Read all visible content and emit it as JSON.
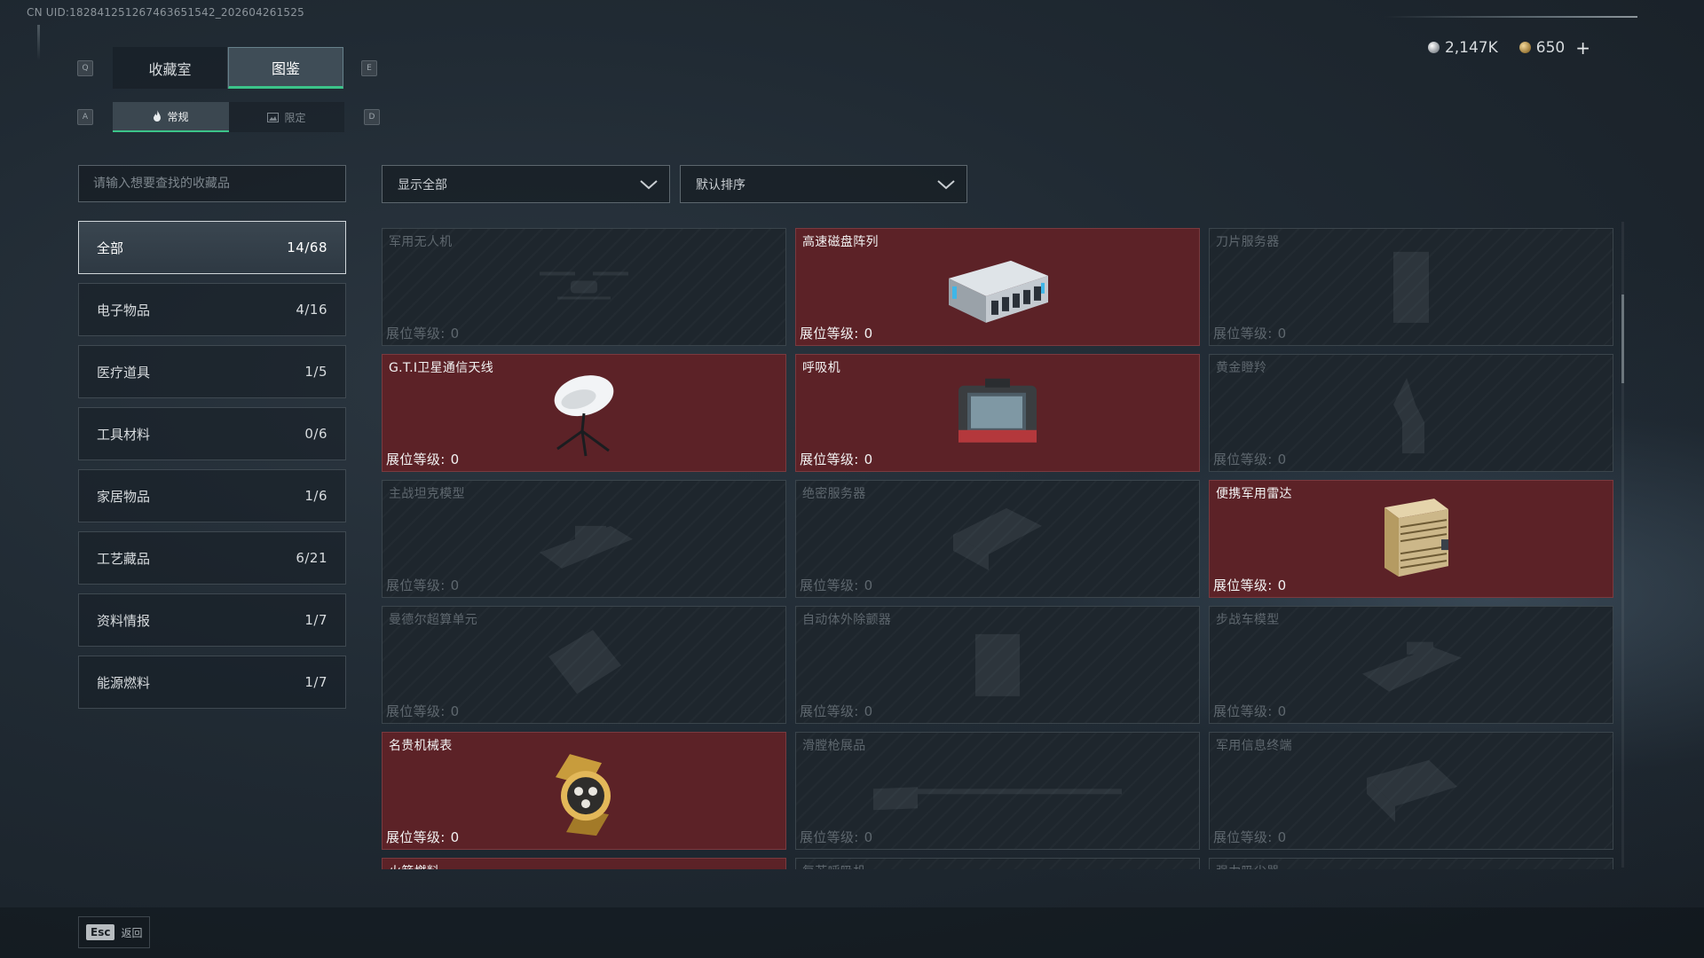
{
  "uid_text": "CN UID:18284125126746365154​2_202604261525",
  "key_hints": {
    "prev_tab": "Q",
    "next_tab": "E",
    "prev_sub": "A",
    "next_sub": "D"
  },
  "main_tabs": [
    {
      "label": "收藏室",
      "active": false
    },
    {
      "label": "图鉴",
      "active": true
    }
  ],
  "sub_tabs": [
    {
      "label": "常规",
      "icon": "flame-icon",
      "active": true
    },
    {
      "label": "限定",
      "icon": "image-icon",
      "active": false
    }
  ],
  "currency": {
    "silver": "2,147K",
    "gold": "650",
    "plus": "+"
  },
  "search": {
    "placeholder": "请输入想要查找的收藏品"
  },
  "filter": {
    "selected": "显示全部"
  },
  "sort": {
    "selected": "默认排序"
  },
  "categories": [
    {
      "label": "全部",
      "count": "14/68",
      "active": true
    },
    {
      "label": "电子物品",
      "count": "4/16"
    },
    {
      "label": "医疗道具",
      "count": "1/5"
    },
    {
      "label": "工具材料",
      "count": "0/6"
    },
    {
      "label": "家居物品",
      "count": "1/6"
    },
    {
      "label": "工艺藏品",
      "count": "6/21"
    },
    {
      "label": "资料情报",
      "count": "1/7"
    },
    {
      "label": "能源燃料",
      "count": "1/7"
    }
  ],
  "level_label": "展位等级:",
  "items": [
    {
      "name": "军用无人机",
      "level": "0",
      "owned": false,
      "icon": "drone-icon"
    },
    {
      "name": "高速磁盘阵列",
      "level": "0",
      "owned": true,
      "icon": "disk-array-icon"
    },
    {
      "name": "刀片服务器",
      "level": "0",
      "owned": false,
      "icon": "blade-server-icon"
    },
    {
      "name": "G.T.I卫星通信天线",
      "level": "0",
      "owned": true,
      "icon": "satellite-dish-icon"
    },
    {
      "name": "呼吸机",
      "level": "0",
      "owned": true,
      "icon": "ventilator-icon"
    },
    {
      "name": "黄金瞪羚",
      "level": "0",
      "owned": false,
      "icon": "gazelle-statue-icon"
    },
    {
      "name": "主战坦克模型",
      "level": "0",
      "owned": false,
      "icon": "tank-model-icon"
    },
    {
      "name": "绝密服务器",
      "level": "0",
      "owned": false,
      "icon": "server-icon"
    },
    {
      "name": "便携军用雷达",
      "level": "0",
      "owned": true,
      "icon": "radar-icon"
    },
    {
      "name": "曼德尔超算单元",
      "level": "0",
      "owned": false,
      "icon": "supercomputer-icon"
    },
    {
      "name": "自动体外除颤器",
      "level": "0",
      "owned": false,
      "icon": "defibrillator-icon"
    },
    {
      "name": "步战车模型",
      "level": "0",
      "owned": false,
      "icon": "ifv-model-icon"
    },
    {
      "name": "名贵机械表",
      "level": "0",
      "owned": true,
      "icon": "watch-icon"
    },
    {
      "name": "滑膛枪展品",
      "level": "0",
      "owned": false,
      "icon": "musket-icon"
    },
    {
      "name": "军用信息终端",
      "level": "0",
      "owned": false,
      "icon": "terminal-icon"
    },
    {
      "name": "火箭燃料",
      "level": "",
      "owned": true,
      "icon": "rocket-fuel-icon"
    },
    {
      "name": "复苏呼吸机",
      "level": "",
      "owned": false,
      "icon": "resuscitator-icon"
    },
    {
      "name": "强力吸尘器",
      "level": "",
      "owned": false,
      "icon": "vacuum-icon"
    }
  ],
  "footer": {
    "esc_key": "Esc",
    "back_label": "返回"
  },
  "colors": {
    "accent_green": "#3bc489",
    "owned_card": "#5c2227",
    "locked_card": "#1e262d"
  }
}
